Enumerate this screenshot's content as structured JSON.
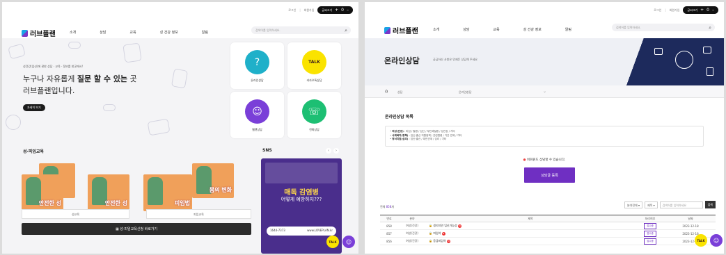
{
  "common": {
    "logo": "러브플랜",
    "nav": [
      "소개",
      "상담",
      "교육",
      "성 건강 정보",
      "알림"
    ],
    "search_placeholder": "검색어를 입력하세요.",
    "topbar": {
      "login": "로그인",
      "join": "회원가입",
      "font_label": "글씨크기",
      "plus": "+",
      "zero": "0",
      "minus": "–"
    },
    "talk_label": "TALK"
  },
  "left": {
    "hero_small": "성건강(임신)에 관한 상담 · 교육 · 정보를 한곳에서!",
    "hero_line1_pre": "누구나 자유롭게 ",
    "hero_line1_hl": "질문 할 수 있는",
    "hero_line1_post": " 곳",
    "hero_line2": "러브플랜입니다.",
    "more_btn": "자세히 보기",
    "cards": [
      {
        "label": "온라인상담",
        "color": "#1fb0c9",
        "icon": "?"
      },
      {
        "label": "카카오톡상담",
        "color": "#fae300",
        "icon": "TALK"
      },
      {
        "label": "웹챗상담",
        "color": "#7a3fd8",
        "icon": "☺"
      },
      {
        "label": "전화상담",
        "color": "#1dbf73",
        "icon": "☏"
      }
    ],
    "edu_title": "성·피임교육",
    "books": [
      {
        "title": "안전한 성",
        "label": "성교육"
      },
      {
        "title": "피임법",
        "label": "피임교육"
      }
    ],
    "book_titles_extra": [
      "몸의 변화"
    ],
    "edu_bar": "성·피임교육신청 바로가기",
    "sns_title": "SNS",
    "sns_t1": "매독 감염병",
    "sns_t2": "어떻게 예방하지???",
    "sns_phone": "1644-7373",
    "sns_url": "www.LOVEPLAN.kr",
    "sns_prev": "‹",
    "sns_next": "›"
  },
  "right": {
    "banner_title": "온라인상담",
    "banner_desc": "궁금하신 사항은 언제든 상담해 주세요",
    "crumb1": "상담",
    "crumb2": "온라인상담",
    "list_title": "온라인상담 목록",
    "info": [
      {
        "head": "여성(건강)",
        "text": " : 피임 / 월경 / 임신 / 부인과질환 / 성건강 / 기타"
      },
      {
        "head": "사회복지(정책)",
        "text": " : 임신·출산 지원정책 / 관련법령 / 기관 연계 / 기타"
      },
      {
        "head": "정서지원(심리)",
        "text": " : 임신·출산 / 대인관계 / 심리 / 기타"
      }
    ],
    "note": "비회원도 상담할 수 있습니다.",
    "note_mark": "●",
    "register_btn": "상담글 등록",
    "total_pre": "전체 ",
    "total_num": "858",
    "total_post": "개",
    "filter_sel1": "분야전체",
    "filter_sel2": "제목",
    "filter_placeholder": "검색어를 입력하세요",
    "filter_btn": "검색",
    "columns": [
      "번호",
      "분야",
      "제목",
      "처리여부",
      "날짜"
    ],
    "rows": [
      {
        "no": "858",
        "cat": "여성(건강)",
        "title": "생리지연 임신가능성",
        "status": "접수중",
        "date": "2023-12-18"
      },
      {
        "no": "857",
        "cat": "여성(건강)",
        "title": "피임약",
        "status": "접수중",
        "date": "2023-12-18"
      },
      {
        "no": "856",
        "cat": "여성(건강)",
        "title": "응급피임약",
        "status": "접수중",
        "date": "2023-12-17"
      }
    ]
  }
}
